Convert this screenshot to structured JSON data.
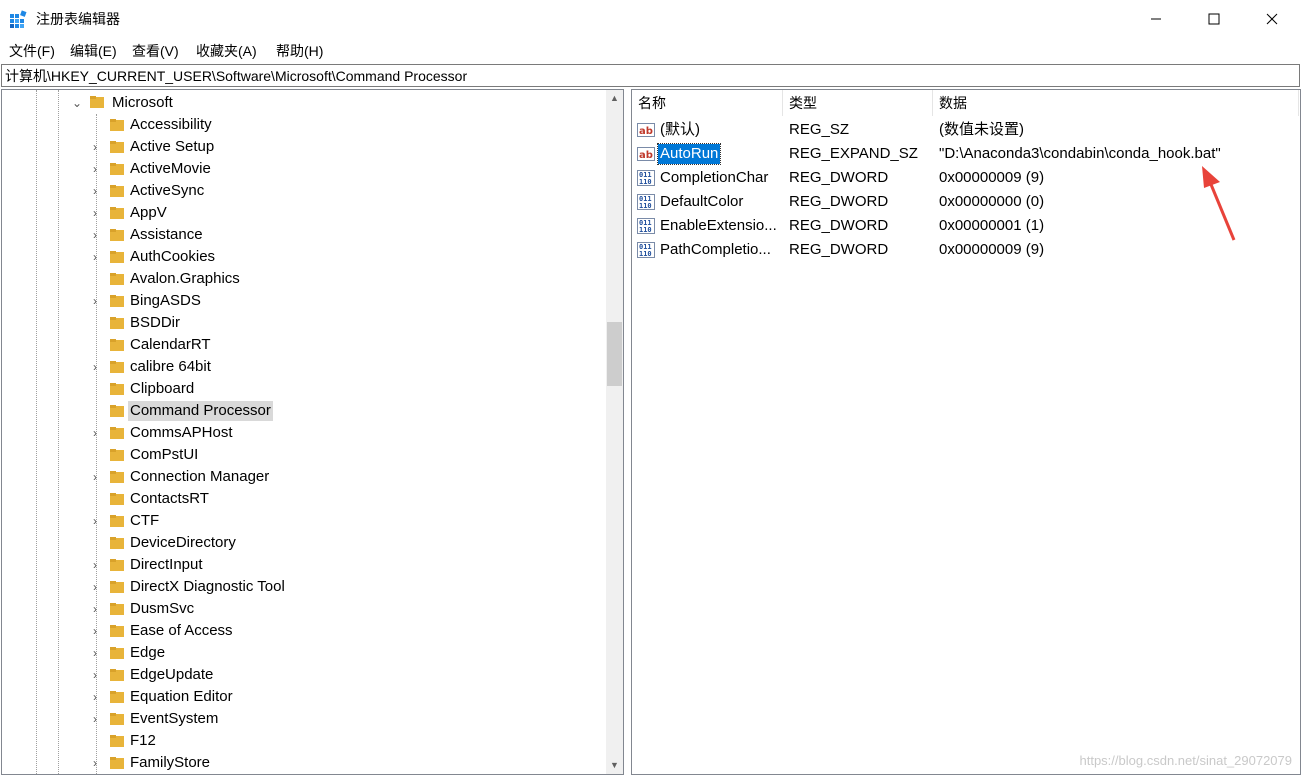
{
  "window": {
    "title": "注册表编辑器",
    "minimize_glyph": "—",
    "maximize_glyph": "☐",
    "close_glyph": "✕"
  },
  "menu": [
    "文件(F)",
    "编辑(E)",
    "查看(V)",
    "收藏夹(A)",
    "帮助(H)"
  ],
  "address": "计算机\\HKEY_CURRENT_USER\\Software\\Microsoft\\Command Processor",
  "tree": {
    "parent": {
      "label": "Microsoft",
      "expanded": true
    },
    "items": [
      {
        "label": "Accessibility",
        "expandable": false
      },
      {
        "label": "Active Setup",
        "expandable": true
      },
      {
        "label": "ActiveMovie",
        "expandable": true
      },
      {
        "label": "ActiveSync",
        "expandable": true
      },
      {
        "label": "AppV",
        "expandable": true
      },
      {
        "label": "Assistance",
        "expandable": true
      },
      {
        "label": "AuthCookies",
        "expandable": true
      },
      {
        "label": "Avalon.Graphics",
        "expandable": false
      },
      {
        "label": "BingASDS",
        "expandable": true
      },
      {
        "label": "BSDDir",
        "expandable": false
      },
      {
        "label": "CalendarRT",
        "expandable": false
      },
      {
        "label": "calibre 64bit",
        "expandable": true
      },
      {
        "label": "Clipboard",
        "expandable": false
      },
      {
        "label": "Command Processor",
        "expandable": false,
        "selected": true
      },
      {
        "label": "CommsAPHost",
        "expandable": true
      },
      {
        "label": "ComPstUI",
        "expandable": false
      },
      {
        "label": "Connection Manager",
        "expandable": true
      },
      {
        "label": "ContactsRT",
        "expandable": false
      },
      {
        "label": "CTF",
        "expandable": true
      },
      {
        "label": "DeviceDirectory",
        "expandable": false
      },
      {
        "label": "DirectInput",
        "expandable": true
      },
      {
        "label": "DirectX Diagnostic Tool",
        "expandable": true
      },
      {
        "label": "DusmSvc",
        "expandable": true
      },
      {
        "label": "Ease of Access",
        "expandable": true
      },
      {
        "label": "Edge",
        "expandable": true
      },
      {
        "label": "EdgeUpdate",
        "expandable": true
      },
      {
        "label": "Equation Editor",
        "expandable": true
      },
      {
        "label": "EventSystem",
        "expandable": true
      },
      {
        "label": "F12",
        "expandable": false
      },
      {
        "label": "FamilyStore",
        "expandable": true
      }
    ]
  },
  "values": {
    "columns": [
      "名称",
      "类型",
      "数据"
    ],
    "rows": [
      {
        "name": "(默认)",
        "type": "REG_SZ",
        "data": "(数值未设置)",
        "icon": "string-value-icon"
      },
      {
        "name": "AutoRun",
        "type": "REG_EXPAND_SZ",
        "data": "\"D:\\Anaconda3\\condabin\\conda_hook.bat\"",
        "icon": "string-value-icon",
        "selected": true
      },
      {
        "name": "CompletionChar",
        "type": "REG_DWORD",
        "data": "0x00000009 (9)",
        "icon": "binary-value-icon"
      },
      {
        "name": "DefaultColor",
        "type": "REG_DWORD",
        "data": "0x00000000 (0)",
        "icon": "binary-value-icon"
      },
      {
        "name": "EnableExtensio...",
        "type": "REG_DWORD",
        "data": "0x00000001 (1)",
        "icon": "binary-value-icon"
      },
      {
        "name": "PathCompletio...",
        "type": "REG_DWORD",
        "data": "0x00000009 (9)",
        "icon": "binary-value-icon"
      }
    ]
  },
  "scroll": {
    "up_glyph": "▲",
    "down_glyph": "▼"
  },
  "watermark": "https://blog.csdn.net/sinat_29072079",
  "colors": {
    "selection": "#0078d7",
    "folder": "#e8b43a",
    "arrow": "#e8433a"
  }
}
